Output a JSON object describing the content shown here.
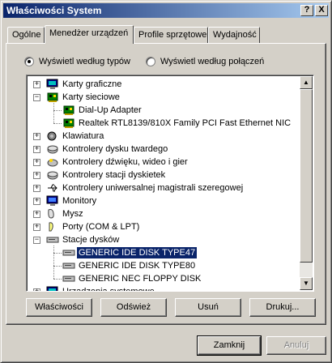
{
  "window": {
    "title": "Właściwości System",
    "help_btn": "?",
    "close_btn": "X"
  },
  "tabs": [
    {
      "label": "Ogólne"
    },
    {
      "label": "Menedżer urządzeń"
    },
    {
      "label": "Profile sprzętowe"
    },
    {
      "label": "Wydajność"
    }
  ],
  "view": {
    "by_type_label": "Wyświetl według typów",
    "by_connection_label": "Wyświetl według połączeń",
    "selected": "by_type"
  },
  "tree": [
    {
      "label": "Karty graficzne",
      "icon": "display-adapter-icon",
      "expander": "+"
    },
    {
      "label": "Karty sieciowe",
      "icon": "network-card-icon",
      "expander": "−"
    },
    {
      "label": "Dial-Up Adapter",
      "icon": "network-card-icon"
    },
    {
      "label": "Realtek RTL8139/810X Family PCI Fast Ethernet NIC",
      "icon": "network-card-icon"
    },
    {
      "label": "Klawiatura",
      "icon": "keyboard-icon",
      "expander": "+"
    },
    {
      "label": "Kontrolery dysku twardego",
      "icon": "disk-controller-icon",
      "expander": "+"
    },
    {
      "label": "Kontrolery dźwięku, wideo i gier",
      "icon": "sound-icon",
      "expander": "+"
    },
    {
      "label": "Kontrolery stacji dyskietek",
      "icon": "floppy-controller-icon",
      "expander": "+"
    },
    {
      "label": "Kontrolery uniwersalnej magistrali szeregowej",
      "icon": "usb-icon",
      "expander": "+"
    },
    {
      "label": "Monitory",
      "icon": "monitor-icon",
      "expander": "+"
    },
    {
      "label": "Mysz",
      "icon": "mouse-icon",
      "expander": "+"
    },
    {
      "label": "Porty (COM & LPT)",
      "icon": "port-icon",
      "expander": "+"
    },
    {
      "label": "Stacje dysków",
      "icon": "disk-drive-icon",
      "expander": "−"
    },
    {
      "label": "GENERIC IDE  DISK TYPE47",
      "icon": "disk-drive-icon",
      "selected": true
    },
    {
      "label": "GENERIC IDE  DISK TYPE80",
      "icon": "disk-drive-icon"
    },
    {
      "label": "GENERIC NEC  FLOPPY DISK",
      "icon": "disk-drive-icon"
    },
    {
      "label": "Urządzenia systemowe",
      "icon": "system-device-icon",
      "expander": "+"
    }
  ],
  "buttons": {
    "properties": "Właściwości",
    "refresh": "Odśwież",
    "remove": "Usuń",
    "print": "Drukuj...",
    "close": "Zamknij",
    "cancel": "Anuluj"
  }
}
